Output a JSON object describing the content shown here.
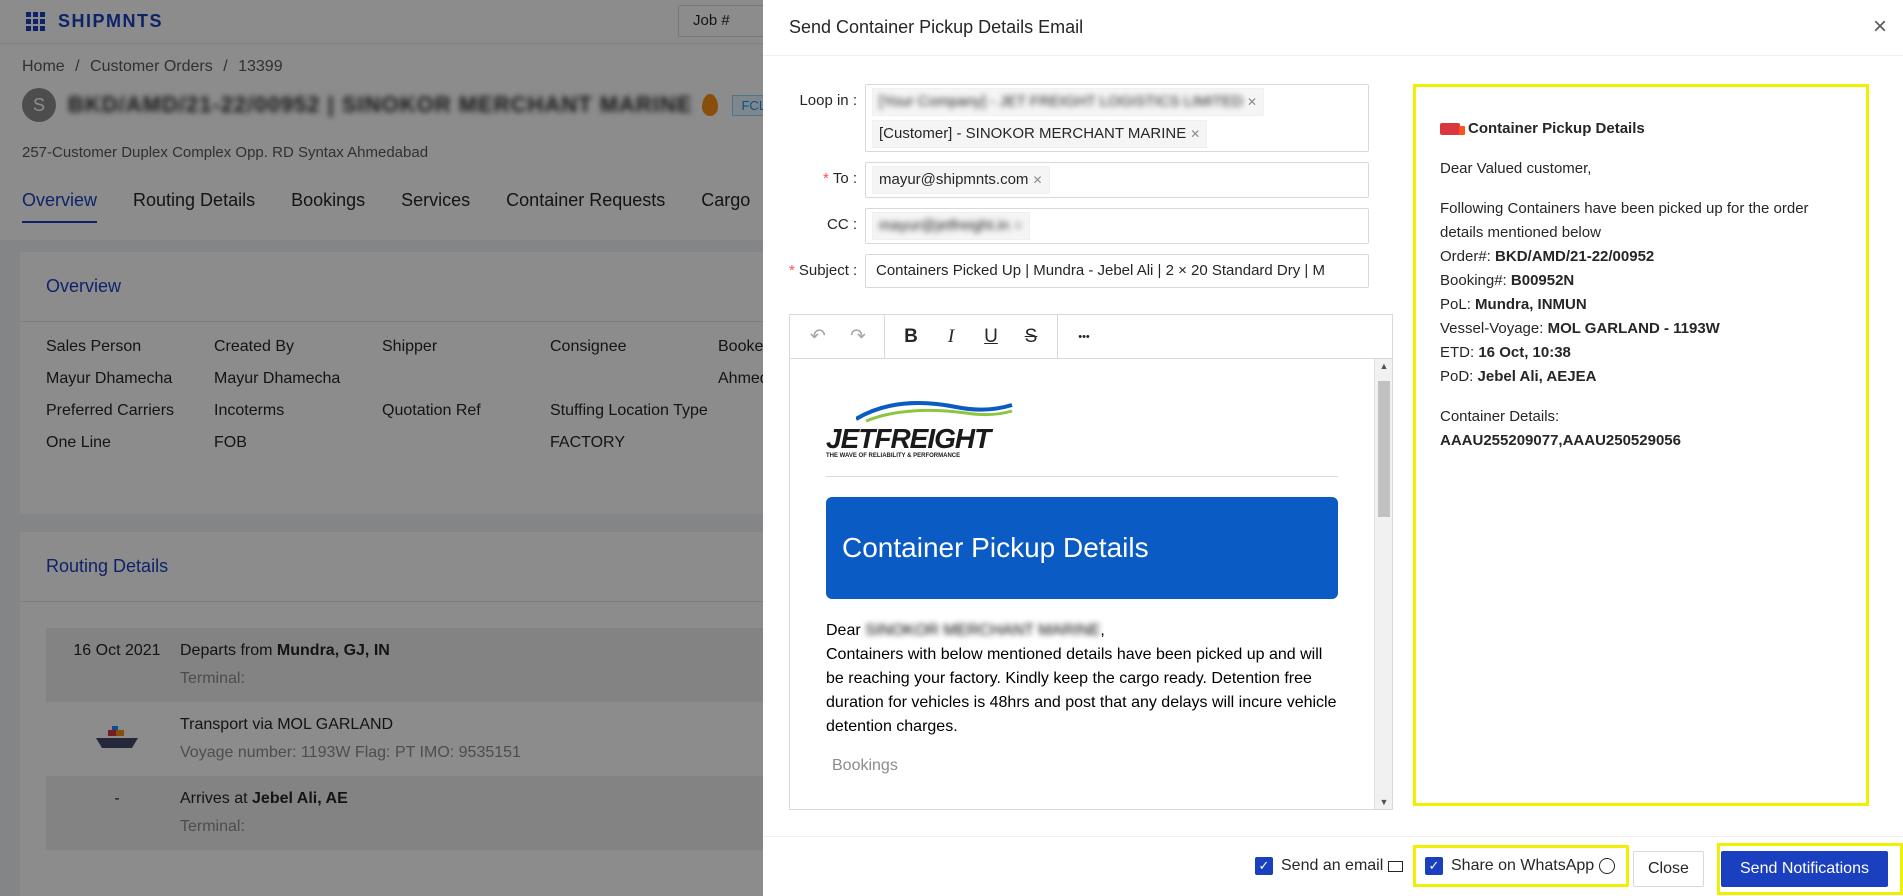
{
  "app": {
    "brand": "SHIPMNTS",
    "job_select": "Job #",
    "breadcrumb": [
      "Home",
      "/",
      "Customer Orders",
      "/",
      "13399"
    ],
    "avatar_letter": "S",
    "order_title_blurred": "BKD/AMD/21-22/00952 | SINOKOR MERCHANT MARINE",
    "type_tag": "FCL",
    "address": "257-Customer Duplex Complex Opp. RD Syntax Ahmedabad",
    "tabs": [
      "Overview",
      "Routing Details",
      "Bookings",
      "Services",
      "Container Requests",
      "Cargo"
    ],
    "overview": {
      "title": "Overview",
      "grid": [
        "Sales Person",
        "Created By",
        "Shipper",
        "Consignee",
        "Booked",
        "Mayur Dhamecha",
        "Mayur Dhamecha",
        "",
        "",
        "Ahmed",
        "Preferred Carriers",
        "Incoterms",
        "Quotation Ref",
        "Stuffing Location Type",
        "",
        "One Line",
        "FOB",
        "",
        "FACTORY",
        ""
      ]
    },
    "routing": {
      "title": "Routing Details",
      "rows": [
        {
          "date": "16 Oct 2021",
          "main_prefix": "Departs from ",
          "main_bold": "Mundra, GJ, IN",
          "sub": "Terminal:"
        },
        {
          "date": "",
          "main_prefix": "Transport via MOL GARLAND",
          "main_bold": "",
          "sub": "Voyage number: 1193W  Flag: PT  IMO: 9535151"
        },
        {
          "date": "-",
          "main_prefix": "Arrives at ",
          "main_bold": "Jebel Ali, AE",
          "sub": "Terminal:"
        }
      ]
    }
  },
  "drawer": {
    "title": "Send Container Pickup Details Email",
    "close_symbol": "×",
    "loop_in_label": "Loop in",
    "loop_in_tags": [
      "[Your Company] - JET FREIGHT LOGISTICS LIMITED",
      "[Customer] - SINOKOR MERCHANT MARINE"
    ],
    "to_label": "To",
    "to_tags": [
      "mayur@shipmnts.com"
    ],
    "cc_label": "CC",
    "cc_tags": [
      "mayur@jetfreight.in"
    ],
    "subject_label": "Subject",
    "subject_value": "Containers Picked Up | Mundra - Jebel Ali | 2 × 20 Standard Dry | M",
    "toolbar": {
      "undo": "↶",
      "redo": "↷",
      "bold": "B",
      "italic": "I",
      "underline": "U",
      "strike": "S",
      "more": "•••"
    },
    "email": {
      "logo_main": "JETFREIGHT",
      "logo_tagline": "THE WAVE OF RELIABILITY & PERFORMANCE",
      "banner": "Container Pickup Details",
      "dear": "Dear",
      "dear_name_blurred": "SINOKOR MERCHANT MARINE",
      "body": "Containers with below mentioned details have been picked up and will be reaching your factory. Kindly keep the cargo ready. Detention free duration for vehicles is 48hrs and post that any delays will incure vehicle detention charges.",
      "bookings": "Bookings"
    },
    "preview": {
      "title": "Container Pickup Details",
      "greeting": "Dear Valued customer,",
      "intro": "Following Containers have been picked up for the order details mentioned below",
      "fields": [
        {
          "label": "Order#: ",
          "value": "BKD/AMD/21-22/00952"
        },
        {
          "label": "Booking#: ",
          "value": "B00952N"
        },
        {
          "label": "PoL: ",
          "value": "Mundra, INMUN"
        },
        {
          "label": "Vessel-Voyage: ",
          "value": "MOL GARLAND - 1193W"
        },
        {
          "label": "ETD: ",
          "value": "16 Oct, 10:38"
        },
        {
          "label": "PoD: ",
          "value": "Jebel Ali, AEJEA"
        }
      ],
      "container_label": "Container Details:",
      "container_value": "AAAU255209077,AAAU250529056"
    },
    "footer": {
      "send_email": "Send an email",
      "share_whatsapp": "Share on WhatsApp",
      "close": "Close",
      "send_notifications": "Send Notifications"
    }
  }
}
